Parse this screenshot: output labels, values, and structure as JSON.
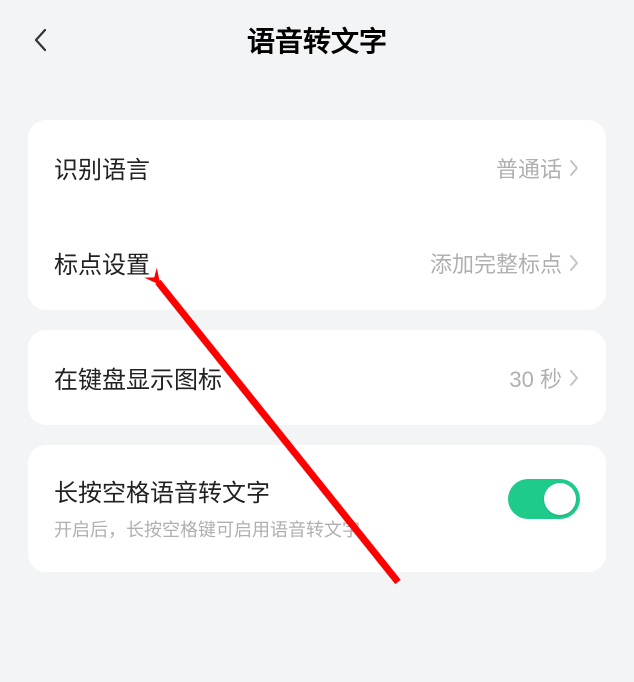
{
  "header": {
    "title": "语音转文字"
  },
  "group1": {
    "rows": [
      {
        "label": "识别语言",
        "value": "普通话"
      },
      {
        "label": "标点设置",
        "value": "添加完整标点"
      }
    ]
  },
  "group2": {
    "rows": [
      {
        "label": "在键盘显示图标",
        "value": "30 秒"
      }
    ]
  },
  "group3": {
    "toggle": {
      "title": "长按空格语音转文字",
      "subtitle": "开启后，长按空格键可启用语音转文字",
      "on": true
    }
  }
}
